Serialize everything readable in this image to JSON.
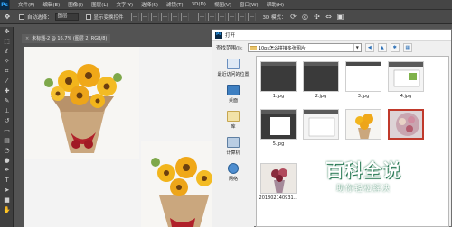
{
  "app": {
    "logo": "Ps",
    "menu": [
      "文件(F)",
      "编辑(E)",
      "图像(I)",
      "图层(L)",
      "文字(Y)",
      "选择(S)",
      "滤镜(T)",
      "3D(D)",
      "视图(V)",
      "窗口(W)",
      "帮助(H)"
    ]
  },
  "options": {
    "auto_select_label": "自动选择：",
    "auto_select_value": "图层",
    "show_transform_label": "显示变换控件",
    "mode_3d_label": "3D 模式："
  },
  "document": {
    "tab_title": "未标题-2 @ 16.7% (图层 2, RGB/8)",
    "close": "×"
  },
  "dialog": {
    "title": "打开",
    "look_in_label": "查找范围(I):",
    "folder": "10ps怎么拼接多张图片",
    "places": [
      {
        "label": "最近访问的位置",
        "icon": "recent-places-icon"
      },
      {
        "label": "桌面",
        "icon": "desktop-icon"
      },
      {
        "label": "库",
        "icon": "library-icon"
      },
      {
        "label": "计算机",
        "icon": "computer-icon"
      },
      {
        "label": "网络",
        "icon": "network-icon"
      }
    ],
    "files": [
      {
        "name": "1.jpg"
      },
      {
        "name": "2.jpg"
      },
      {
        "name": "3.jpg"
      },
      {
        "name": "4.jpg"
      },
      {
        "name": "5.jpg"
      },
      {
        "name": ""
      },
      {
        "name": ""
      },
      {
        "name": ""
      },
      {
        "name": "201802140931..."
      }
    ]
  },
  "watermark": {
    "title": "百科全说",
    "subtitle": "助你轻松解决"
  }
}
